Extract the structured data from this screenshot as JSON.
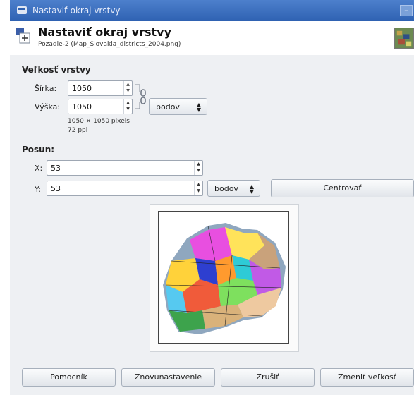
{
  "window": {
    "title": "Nastaviť okraj vrstvy"
  },
  "header": {
    "title": "Nastaviť okraj vrstvy",
    "subtitle": "Pozadie-2 (Map_Slovakia_districts_2004.png)"
  },
  "size_section": {
    "title": "Veľkosť vrstvy",
    "width_label": "Šírka:",
    "width_value": "1050",
    "height_label": "Výška:",
    "height_value": "1050",
    "unit": "bodov",
    "info_pixels": "1050 × 1050 pixels",
    "info_ppi": "72 ppi"
  },
  "offset_section": {
    "title": "Posun:",
    "x_label": "X:",
    "x_value": "53",
    "y_label": "Y:",
    "y_value": "53",
    "unit": "bodov",
    "center_label": "Centrovať"
  },
  "buttons": {
    "help": "Pomocník",
    "reset": "Znovunastavenie",
    "cancel": "Zrušiť",
    "resize": "Zmeniť veľkosť"
  },
  "colors": {
    "titlebar": "#3a6dbf",
    "accent": "#2f62b2"
  },
  "icons": {
    "title": "window-menu-icon",
    "header": "layer-resize-icon",
    "chain": "chain-link-icon",
    "spinner": "spinner-arrows-icon"
  }
}
